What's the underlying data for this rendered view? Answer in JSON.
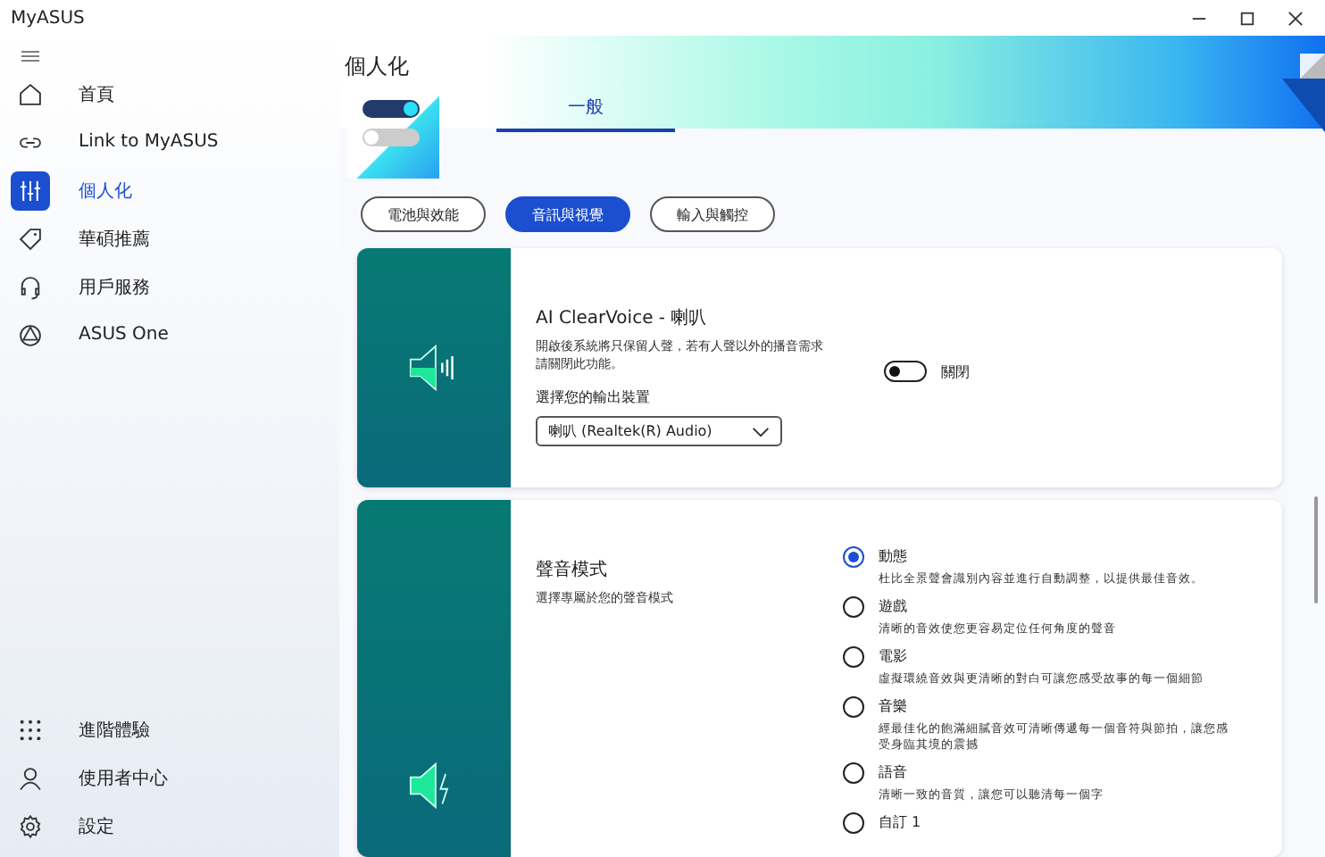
{
  "window": {
    "title": "MyASUS"
  },
  "sidebar": {
    "items": [
      {
        "label": "首頁",
        "selected": false
      },
      {
        "label": "Link to MyASUS",
        "selected": false
      },
      {
        "label": "個人化",
        "selected": true
      },
      {
        "label": "華碩推薦",
        "selected": false
      },
      {
        "label": "用戶服務",
        "selected": false
      },
      {
        "label": "ASUS One",
        "selected": false
      }
    ],
    "bottom_items": [
      {
        "label": "進階體驗"
      },
      {
        "label": "使用者中心"
      },
      {
        "label": "設定"
      }
    ]
  },
  "page": {
    "title": "個人化",
    "tabs": [
      {
        "label": "一般",
        "selected": true
      }
    ],
    "chips": [
      {
        "label": "電池與效能",
        "selected": false
      },
      {
        "label": "音訊與視覺",
        "selected": true
      },
      {
        "label": "輸入與觸控",
        "selected": false
      }
    ]
  },
  "clearvoice": {
    "title": "AI ClearVoice - 喇叭",
    "description": "開啟後系統將只保留人聲，若有人聲以外的播音需求請關閉此功能。",
    "toggle": {
      "on": false,
      "label": "關閉"
    },
    "output_label": "選擇您的輸出裝置",
    "output_value": "喇叭 (Realtek(R) Audio)"
  },
  "sound_mode": {
    "title": "聲音模式",
    "description": "選擇專屬於您的聲音模式",
    "options": [
      {
        "label": "動態",
        "description": "杜比全景聲會識別內容並進行自動調整，以提供最佳音效。",
        "selected": true
      },
      {
        "label": "遊戲",
        "description": "清晰的音效使您更容易定位任何角度的聲音",
        "selected": false
      },
      {
        "label": "電影",
        "description": "虛擬環繞音效與更清晰的對白可讓您感受故事的每一個細節",
        "selected": false
      },
      {
        "label": "音樂",
        "description": "經最佳化的飽滿細膩音效可清晰傳遞每一個音符與節拍，讓您感受身臨其境的震撼",
        "selected": false
      },
      {
        "label": "語音",
        "description": "清晰一致的音質，讓您可以聽清每一個字",
        "selected": false
      },
      {
        "label": "自訂 1",
        "selected": false
      }
    ]
  }
}
